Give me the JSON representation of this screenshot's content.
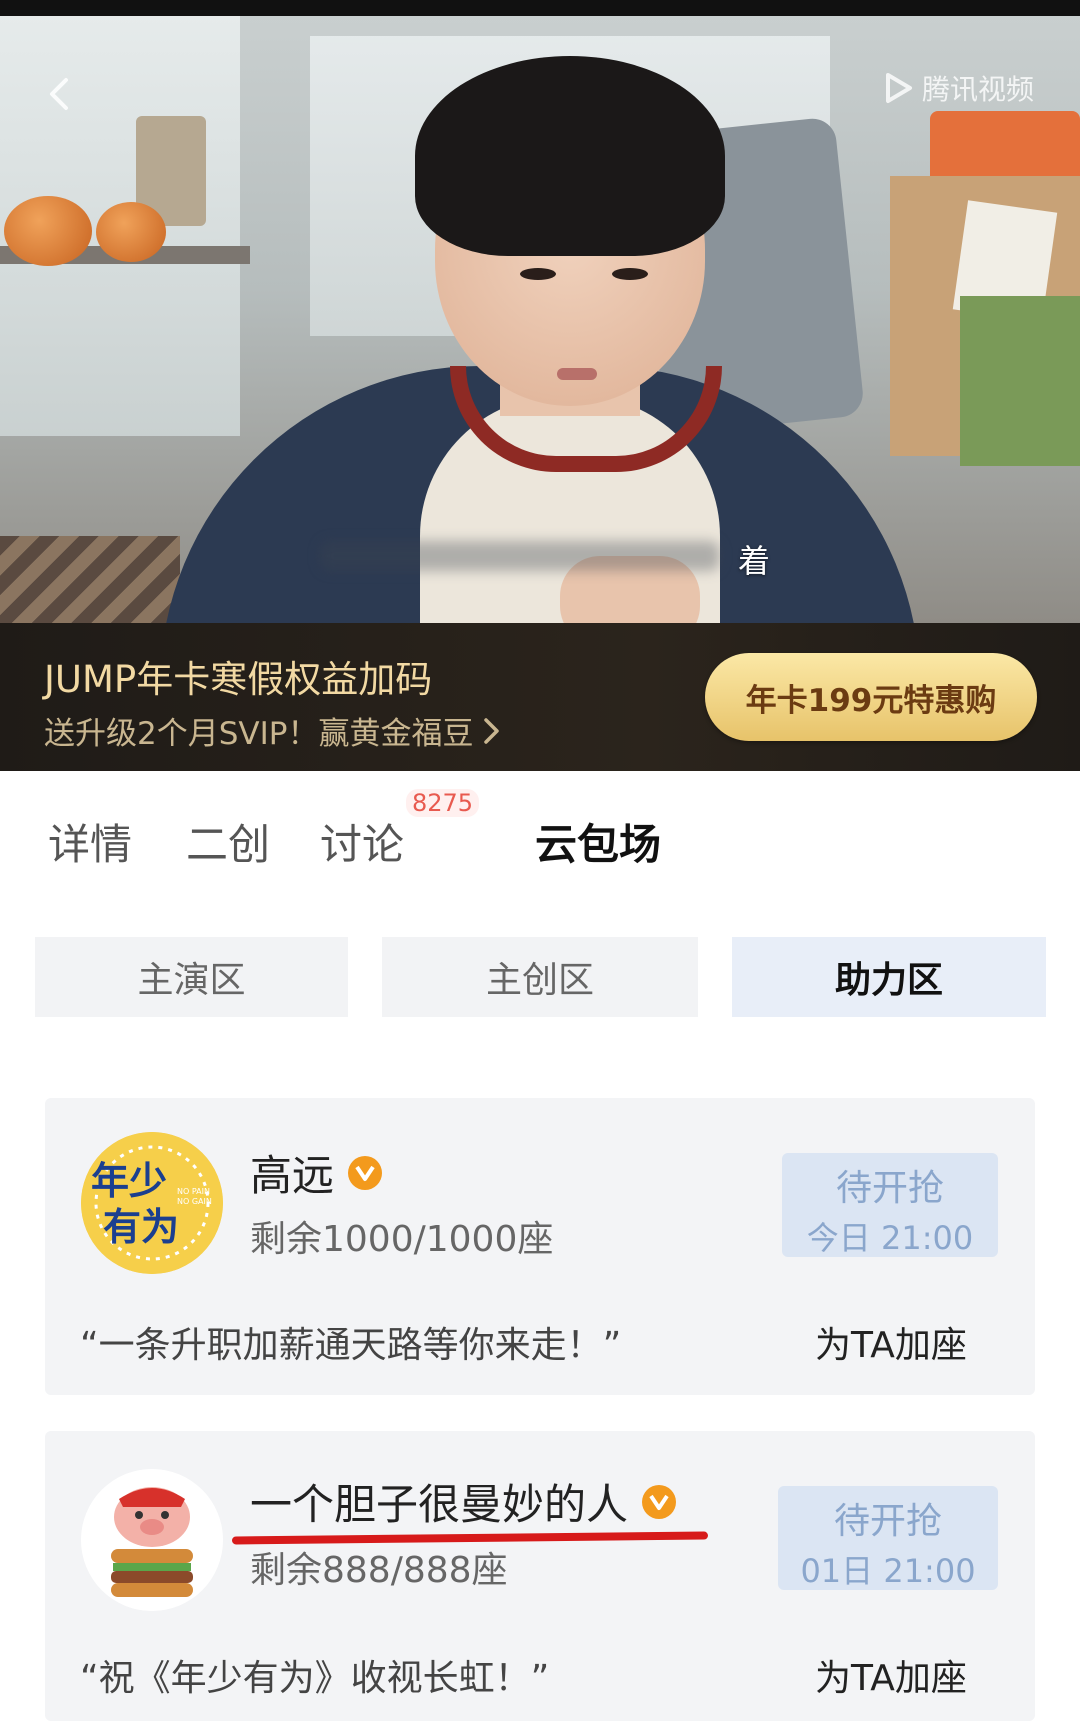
{
  "video": {
    "brand_label": "腾讯视频",
    "subtitle": "着"
  },
  "promo": {
    "title": "JUMP年卡寒假权益加码",
    "subtitle": "送升级2个月SVIP！赢黄金福豆",
    "button": "年卡199元特惠购"
  },
  "tabs": [
    {
      "label": "详情"
    },
    {
      "label": "二创"
    },
    {
      "label": "讨论",
      "badge": "8275"
    },
    {
      "label": "云包场"
    }
  ],
  "segments": [
    {
      "label": "主演区"
    },
    {
      "label": "主创区"
    },
    {
      "label": "助力区"
    }
  ],
  "cards": [
    {
      "avatar_text": "年少有为",
      "avatar_small": "NO PAIN NO GAIN",
      "name": "高远",
      "seats": "剩余1000/1000座",
      "status": "待开抢",
      "time": "今日 21:00",
      "quote": "“一条升职加薪通天路等你来走！”",
      "action": "为TA加座"
    },
    {
      "name": "一个胆子很曼妙的人",
      "seats": "剩余888/888座",
      "status": "待开抢",
      "time": "01日 21:00",
      "quote": "“祝《年少有为》收视长虹！”",
      "action": "为TA加座"
    }
  ],
  "colors": {
    "accent_gold": "#f2d9a3",
    "badge_red": "#e85a4f",
    "verified_orange": "#f39a1d",
    "status_blue": "#8aa6cc",
    "underline_red": "#d71a1a"
  }
}
